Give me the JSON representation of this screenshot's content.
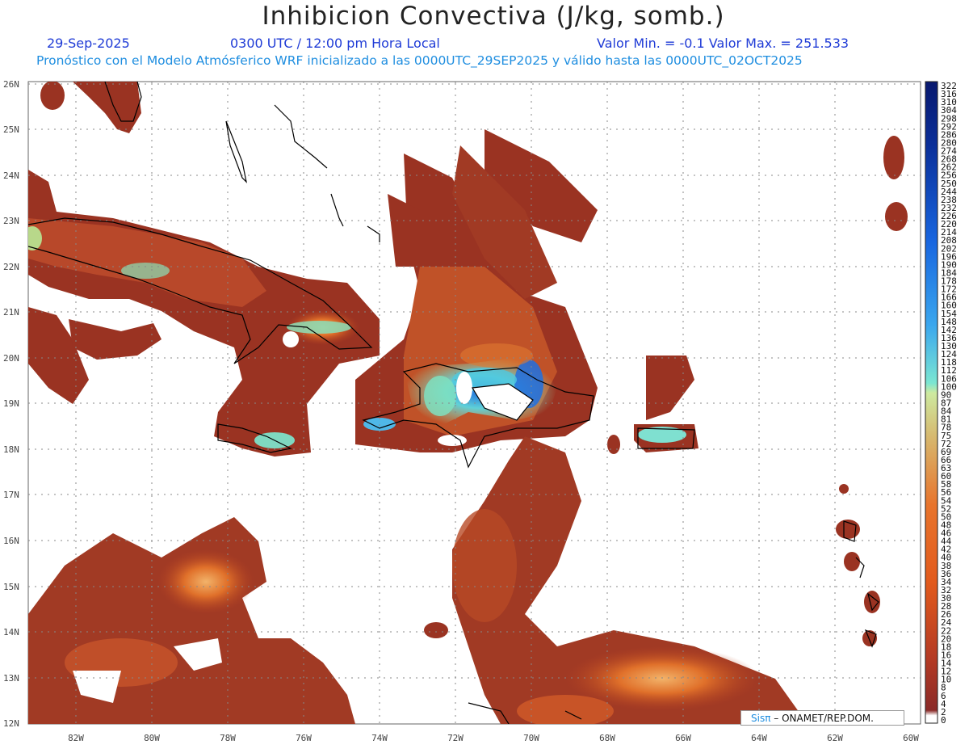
{
  "header": {
    "title": "Inhibicion Convectiva (J/kg, somb.)",
    "date": "29-Sep-2025",
    "time": "0300 UTC / 12:00 pm Hora Local",
    "minmax": "Valor Min. = -0.1  Valor Max. = 251.533",
    "model_line": "Pronóstico con el Modelo Atmósferico WRF inicializado a las 0000UTC_29SEP2025 y válido hasta las  0000UTC_02OCT2025"
  },
  "map": {
    "lat_labels": [
      "26N",
      "25N",
      "24N",
      "23N",
      "22N",
      "21N",
      "20N",
      "19N",
      "18N",
      "17N",
      "16N",
      "15N",
      "14N",
      "13N",
      "12N"
    ],
    "lon_labels": [
      "82W",
      "80W",
      "78W",
      "76W",
      "74W",
      "72W",
      "70W",
      "68W",
      "66W",
      "64W",
      "62W",
      "60W"
    ],
    "extent": {
      "lon_min": -83.2,
      "lon_max": -60.3,
      "lat_min": 11.9,
      "lat_max": 26.1
    },
    "colors": {
      "low": "#8b2a1e",
      "mid": "#c8501e",
      "orange": "#e47a2e",
      "teal": "#7ee0c8",
      "blue": "#1e6fe0",
      "coast": "#000000",
      "grid": "#888888"
    }
  },
  "colorbar": {
    "labels": [
      "322",
      "316",
      "310",
      "304",
      "298",
      "292",
      "286",
      "280",
      "274",
      "268",
      "262",
      "256",
      "250",
      "244",
      "238",
      "232",
      "226",
      "220",
      "214",
      "208",
      "202",
      "196",
      "190",
      "184",
      "178",
      "172",
      "166",
      "160",
      "154",
      "148",
      "142",
      "136",
      "130",
      "124",
      "118",
      "112",
      "106",
      "100",
      "90",
      "87",
      "84",
      "81",
      "78",
      "75",
      "72",
      "69",
      "66",
      "63",
      "60",
      "58",
      "56",
      "54",
      "52",
      "50",
      "48",
      "46",
      "44",
      "42",
      "40",
      "38",
      "36",
      "34",
      "32",
      "30",
      "28",
      "26",
      "24",
      "22",
      "20",
      "18",
      "16",
      "14",
      "12",
      "10",
      "8",
      "6",
      "4",
      "2",
      "0"
    ]
  },
  "credit": {
    "sis": "Sisπ",
    "rest": "– ONAMET/REP.DOM."
  },
  "chart_data": {
    "type": "heatmap",
    "title": "Inhibicion Convectiva (J/kg, somb.)",
    "colorbar_levels": [
      0,
      2,
      4,
      6,
      8,
      10,
      12,
      14,
      16,
      18,
      20,
      22,
      24,
      26,
      28,
      30,
      32,
      34,
      36,
      38,
      40,
      42,
      44,
      46,
      48,
      50,
      52,
      54,
      56,
      58,
      60,
      63,
      66,
      69,
      72,
      75,
      78,
      81,
      84,
      87,
      90,
      100,
      106,
      112,
      118,
      124,
      130,
      136,
      142,
      148,
      154,
      160,
      166,
      172,
      178,
      184,
      190,
      196,
      202,
      208,
      214,
      220,
      226,
      232,
      238,
      244,
      250,
      256,
      262,
      268,
      274,
      280,
      286,
      292,
      298,
      304,
      310,
      316,
      322
    ],
    "value_min": -0.1,
    "value_max": 251.533,
    "x_ticks": [
      "82W",
      "80W",
      "78W",
      "76W",
      "74W",
      "72W",
      "70W",
      "68W",
      "66W",
      "64W",
      "62W",
      "60W"
    ],
    "y_ticks": [
      "12N",
      "13N",
      "14N",
      "15N",
      "16N",
      "17N",
      "18N",
      "19N",
      "20N",
      "21N",
      "22N",
      "23N",
      "24N",
      "25N",
      "26N"
    ],
    "grid": true,
    "legend": "right"
  }
}
